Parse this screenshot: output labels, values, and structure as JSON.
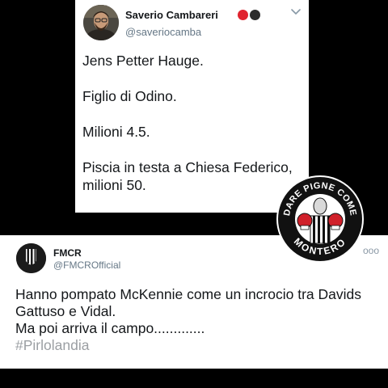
{
  "tweet1": {
    "author_name": "Saverio Cambareri",
    "author_handle": "@saveriocamba",
    "name_emojis": [
      "red-circle",
      "black-circle"
    ],
    "accent_colors": {
      "red": "#e0242f",
      "black": "#2b2b2b"
    },
    "body": [
      "Jens Petter Hauge.",
      "Figlio di Odino.",
      "Milioni 4.5.",
      "Piscia in testa a Chiesa Federico, milioni 50."
    ]
  },
  "logo": {
    "text_top": "DARE PIGNE COME",
    "text_bottom": "MONTERO"
  },
  "tweet2": {
    "author_name": "FMCR",
    "author_handle": "@FMCROfficial",
    "more_label": "ooo",
    "body": [
      "Hanno pompato McKennie come un incrocio tra Davids",
      "Gattuso e Vidal.",
      "Ma poi arriva il campo............."
    ],
    "hashtag": "#Pirlolandia",
    "hashtag_color": "#9b9fa3"
  }
}
